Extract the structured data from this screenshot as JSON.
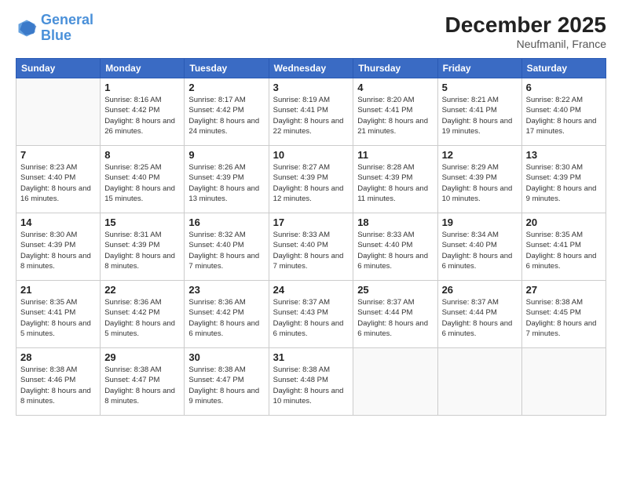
{
  "header": {
    "logo_line1": "General",
    "logo_line2": "Blue",
    "month_year": "December 2025",
    "location": "Neufmanil, France"
  },
  "weekdays": [
    "Sunday",
    "Monday",
    "Tuesday",
    "Wednesday",
    "Thursday",
    "Friday",
    "Saturday"
  ],
  "weeks": [
    [
      {
        "day": "",
        "sunrise": "",
        "sunset": "",
        "daylight": ""
      },
      {
        "day": "1",
        "sunrise": "Sunrise: 8:16 AM",
        "sunset": "Sunset: 4:42 PM",
        "daylight": "Daylight: 8 hours and 26 minutes."
      },
      {
        "day": "2",
        "sunrise": "Sunrise: 8:17 AM",
        "sunset": "Sunset: 4:42 PM",
        "daylight": "Daylight: 8 hours and 24 minutes."
      },
      {
        "day": "3",
        "sunrise": "Sunrise: 8:19 AM",
        "sunset": "Sunset: 4:41 PM",
        "daylight": "Daylight: 8 hours and 22 minutes."
      },
      {
        "day": "4",
        "sunrise": "Sunrise: 8:20 AM",
        "sunset": "Sunset: 4:41 PM",
        "daylight": "Daylight: 8 hours and 21 minutes."
      },
      {
        "day": "5",
        "sunrise": "Sunrise: 8:21 AM",
        "sunset": "Sunset: 4:41 PM",
        "daylight": "Daylight: 8 hours and 19 minutes."
      },
      {
        "day": "6",
        "sunrise": "Sunrise: 8:22 AM",
        "sunset": "Sunset: 4:40 PM",
        "daylight": "Daylight: 8 hours and 17 minutes."
      }
    ],
    [
      {
        "day": "7",
        "sunrise": "Sunrise: 8:23 AM",
        "sunset": "Sunset: 4:40 PM",
        "daylight": "Daylight: 8 hours and 16 minutes."
      },
      {
        "day": "8",
        "sunrise": "Sunrise: 8:25 AM",
        "sunset": "Sunset: 4:40 PM",
        "daylight": "Daylight: 8 hours and 15 minutes."
      },
      {
        "day": "9",
        "sunrise": "Sunrise: 8:26 AM",
        "sunset": "Sunset: 4:39 PM",
        "daylight": "Daylight: 8 hours and 13 minutes."
      },
      {
        "day": "10",
        "sunrise": "Sunrise: 8:27 AM",
        "sunset": "Sunset: 4:39 PM",
        "daylight": "Daylight: 8 hours and 12 minutes."
      },
      {
        "day": "11",
        "sunrise": "Sunrise: 8:28 AM",
        "sunset": "Sunset: 4:39 PM",
        "daylight": "Daylight: 8 hours and 11 minutes."
      },
      {
        "day": "12",
        "sunrise": "Sunrise: 8:29 AM",
        "sunset": "Sunset: 4:39 PM",
        "daylight": "Daylight: 8 hours and 10 minutes."
      },
      {
        "day": "13",
        "sunrise": "Sunrise: 8:30 AM",
        "sunset": "Sunset: 4:39 PM",
        "daylight": "Daylight: 8 hours and 9 minutes."
      }
    ],
    [
      {
        "day": "14",
        "sunrise": "Sunrise: 8:30 AM",
        "sunset": "Sunset: 4:39 PM",
        "daylight": "Daylight: 8 hours and 8 minutes."
      },
      {
        "day": "15",
        "sunrise": "Sunrise: 8:31 AM",
        "sunset": "Sunset: 4:39 PM",
        "daylight": "Daylight: 8 hours and 8 minutes."
      },
      {
        "day": "16",
        "sunrise": "Sunrise: 8:32 AM",
        "sunset": "Sunset: 4:40 PM",
        "daylight": "Daylight: 8 hours and 7 minutes."
      },
      {
        "day": "17",
        "sunrise": "Sunrise: 8:33 AM",
        "sunset": "Sunset: 4:40 PM",
        "daylight": "Daylight: 8 hours and 7 minutes."
      },
      {
        "day": "18",
        "sunrise": "Sunrise: 8:33 AM",
        "sunset": "Sunset: 4:40 PM",
        "daylight": "Daylight: 8 hours and 6 minutes."
      },
      {
        "day": "19",
        "sunrise": "Sunrise: 8:34 AM",
        "sunset": "Sunset: 4:40 PM",
        "daylight": "Daylight: 8 hours and 6 minutes."
      },
      {
        "day": "20",
        "sunrise": "Sunrise: 8:35 AM",
        "sunset": "Sunset: 4:41 PM",
        "daylight": "Daylight: 8 hours and 6 minutes."
      }
    ],
    [
      {
        "day": "21",
        "sunrise": "Sunrise: 8:35 AM",
        "sunset": "Sunset: 4:41 PM",
        "daylight": "Daylight: 8 hours and 5 minutes."
      },
      {
        "day": "22",
        "sunrise": "Sunrise: 8:36 AM",
        "sunset": "Sunset: 4:42 PM",
        "daylight": "Daylight: 8 hours and 5 minutes."
      },
      {
        "day": "23",
        "sunrise": "Sunrise: 8:36 AM",
        "sunset": "Sunset: 4:42 PM",
        "daylight": "Daylight: 8 hours and 6 minutes."
      },
      {
        "day": "24",
        "sunrise": "Sunrise: 8:37 AM",
        "sunset": "Sunset: 4:43 PM",
        "daylight": "Daylight: 8 hours and 6 minutes."
      },
      {
        "day": "25",
        "sunrise": "Sunrise: 8:37 AM",
        "sunset": "Sunset: 4:44 PM",
        "daylight": "Daylight: 8 hours and 6 minutes."
      },
      {
        "day": "26",
        "sunrise": "Sunrise: 8:37 AM",
        "sunset": "Sunset: 4:44 PM",
        "daylight": "Daylight: 8 hours and 6 minutes."
      },
      {
        "day": "27",
        "sunrise": "Sunrise: 8:38 AM",
        "sunset": "Sunset: 4:45 PM",
        "daylight": "Daylight: 8 hours and 7 minutes."
      }
    ],
    [
      {
        "day": "28",
        "sunrise": "Sunrise: 8:38 AM",
        "sunset": "Sunset: 4:46 PM",
        "daylight": "Daylight: 8 hours and 8 minutes."
      },
      {
        "day": "29",
        "sunrise": "Sunrise: 8:38 AM",
        "sunset": "Sunset: 4:47 PM",
        "daylight": "Daylight: 8 hours and 8 minutes."
      },
      {
        "day": "30",
        "sunrise": "Sunrise: 8:38 AM",
        "sunset": "Sunset: 4:47 PM",
        "daylight": "Daylight: 8 hours and 9 minutes."
      },
      {
        "day": "31",
        "sunrise": "Sunrise: 8:38 AM",
        "sunset": "Sunset: 4:48 PM",
        "daylight": "Daylight: 8 hours and 10 minutes."
      },
      {
        "day": "",
        "sunrise": "",
        "sunset": "",
        "daylight": ""
      },
      {
        "day": "",
        "sunrise": "",
        "sunset": "",
        "daylight": ""
      },
      {
        "day": "",
        "sunrise": "",
        "sunset": "",
        "daylight": ""
      }
    ]
  ]
}
